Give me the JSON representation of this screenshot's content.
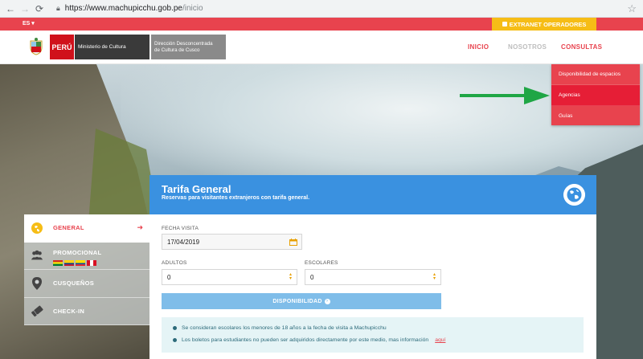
{
  "browser": {
    "url_host": "https://www.machupicchu.gob.pe",
    "url_path": "/inicio"
  },
  "topbar": {
    "language": "ES",
    "extranet_label": "EXTRANET OPERADORES"
  },
  "header": {
    "peru_label": "PERÚ",
    "ministerio_label": "Ministerio de Cultura",
    "direccion_line1": "Dirección Desconcentrada",
    "direccion_line2": "de Cultura de Cusco",
    "nav": {
      "inicio": "INICIO",
      "nosotros": "NOSOTROS",
      "consultas": "CONSULTAS"
    }
  },
  "dropdown": {
    "items": [
      "Disponibilidad de espacios",
      "Agencias",
      "Guías"
    ]
  },
  "panel": {
    "title": "Tarifa General",
    "subtitle": "Reservas para visitantes extranjeros con tarifa general."
  },
  "tabs": {
    "general": "GENERAL",
    "promocional": "PROMOCIONAL",
    "cusquenos": "CUSQUEÑOS",
    "checkin": "CHECK-IN"
  },
  "form": {
    "fecha_label": "FECHA VISITA",
    "fecha_value": "17/04/2019",
    "adultos_label": "ADULTOS",
    "adultos_value": "0",
    "escolares_label": "ESCOLARES",
    "escolares_value": "0",
    "button_label": "DISPONIBILIDAD"
  },
  "info": {
    "line1": "Se consideran escolares los menores de 18 años a la fecha de visita a Machupicchu",
    "line2": "Los boletos para estudiantes no pueden ser adquiridos directamente por este medio, mas información",
    "link": "aquí"
  },
  "colors": {
    "brand_red": "#e8434e",
    "extranet_yellow": "#f6bd16",
    "panel_blue": "#3a91e0",
    "button_blue": "#7fbde9",
    "arrow_green": "#1fa645"
  }
}
